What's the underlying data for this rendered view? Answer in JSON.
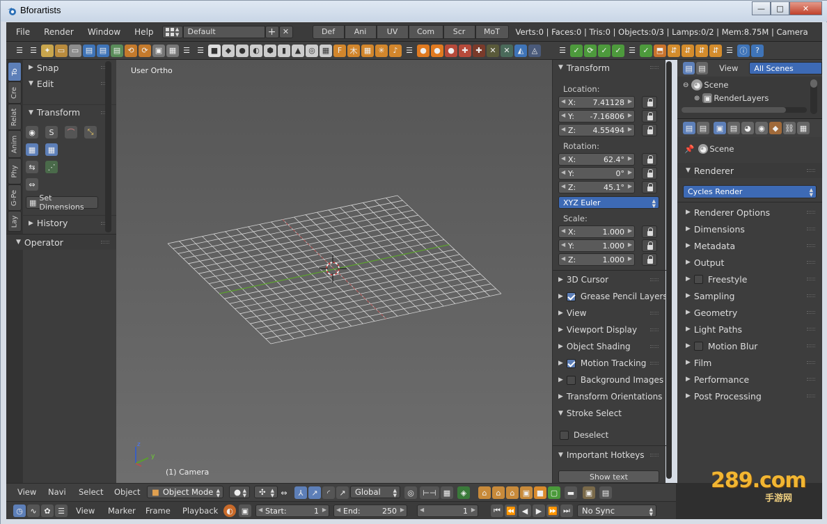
{
  "window": {
    "title": "Bforartists",
    "buttons": {
      "minimize": "—",
      "maximize": "□",
      "close": "✕"
    }
  },
  "menubar": {
    "items": [
      "File",
      "Render",
      "Window",
      "Help"
    ],
    "screen_layout": "Default",
    "workspace_tabs": [
      "Def",
      "Ani",
      "UV",
      "Com",
      "Scr",
      "MoT"
    ],
    "stats": "Verts:0 | Faces:0 | Tris:0 | Objects:0/3 | Lamps:0/2 | Mem:8.75M | Camera"
  },
  "vertical_tabs": [
    "To",
    "Cre",
    "Relat",
    "Anim",
    "Phy",
    "G-Pe",
    "Lay"
  ],
  "tool_shelf": {
    "snap": "Snap",
    "edit": "Edit",
    "transform": "Transform",
    "set_dimensions": "Set Dimensions",
    "history": "History",
    "operator": "Operator"
  },
  "viewport": {
    "view_name": "User Ortho",
    "object_label": "(1) Camera",
    "axis_z": "z",
    "axis_y": "y"
  },
  "properties_panel": {
    "header": "Transform",
    "location_label": "Location:",
    "location": [
      {
        "axis": "X:",
        "value": "7.41128"
      },
      {
        "axis": "Y:",
        "value": "-7.16806"
      },
      {
        "axis": "Z:",
        "value": "4.55494"
      }
    ],
    "rotation_label": "Rotation:",
    "rotation": [
      {
        "axis": "X:",
        "value": "62.4°"
      },
      {
        "axis": "Y:",
        "value": "0°"
      },
      {
        "axis": "Z:",
        "value": "45.1°"
      }
    ],
    "rotation_mode": "XYZ Euler",
    "scale_label": "Scale:",
    "scale": [
      {
        "axis": "X:",
        "value": "1.000"
      },
      {
        "axis": "Y:",
        "value": "1.000"
      },
      {
        "axis": "Z:",
        "value": "1.000"
      }
    ],
    "sections": [
      {
        "label": "3D Cursor",
        "checkbox": null
      },
      {
        "label": "Grease Pencil Layers",
        "checkbox": true
      },
      {
        "label": "View",
        "checkbox": null
      },
      {
        "label": "Viewport Display",
        "checkbox": null
      },
      {
        "label": "Object Shading",
        "checkbox": null
      },
      {
        "label": "Motion Tracking",
        "checkbox": true
      },
      {
        "label": "Background Images",
        "checkbox": false
      },
      {
        "label": "Transform Orientations",
        "checkbox": null
      }
    ],
    "stroke_select": "Stroke Select",
    "deselect": "Deselect",
    "important_hotkeys": "Important Hotkeys",
    "show_text": "Show text"
  },
  "outliner": {
    "view": "View",
    "filter": "All Scenes",
    "items": [
      "Scene",
      "RenderLayers"
    ]
  },
  "render_properties": {
    "context": "Scene",
    "renderer_header": "Renderer",
    "engine": "Cycles Render",
    "sections": [
      {
        "label": "Renderer Options",
        "checkbox": null
      },
      {
        "label": "Dimensions",
        "checkbox": null
      },
      {
        "label": "Metadata",
        "checkbox": null
      },
      {
        "label": "Output",
        "checkbox": null
      },
      {
        "label": "Freestyle",
        "checkbox": false
      },
      {
        "label": "Sampling",
        "checkbox": null
      },
      {
        "label": "Geometry",
        "checkbox": null
      },
      {
        "label": "Light Paths",
        "checkbox": null
      },
      {
        "label": "Motion Blur",
        "checkbox": false
      },
      {
        "label": "Film",
        "checkbox": null
      },
      {
        "label": "Performance",
        "checkbox": null
      },
      {
        "label": "Post Processing",
        "checkbox": null
      }
    ]
  },
  "header3d": {
    "menus": [
      "View",
      "Navi",
      "Select",
      "Object"
    ],
    "mode": "Object Mode",
    "orientation": "Global"
  },
  "timeline": {
    "menus": [
      "View",
      "Marker",
      "Frame",
      "Playback"
    ],
    "start_label": "Start:",
    "start": "1",
    "end_label": "End:",
    "end": "250",
    "current": "1",
    "sync": "No Sync"
  },
  "watermark": {
    "text": "289.com",
    "subtext": "手游网"
  },
  "colors": {
    "accent": "#5d7fb8",
    "grid": "#d8d8d8",
    "x_axis": "#b25050",
    "y_axis": "#5aa02c"
  }
}
